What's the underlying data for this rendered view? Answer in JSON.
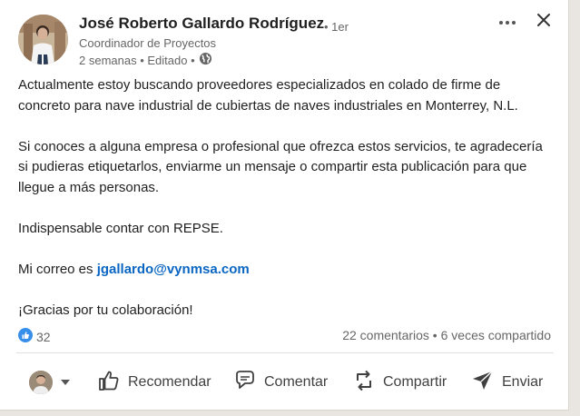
{
  "post": {
    "author": {
      "name": "José Roberto Gallardo Rodríguez",
      "degree": "• 1er",
      "title": "Coordinador de Proyectos",
      "meta": "2 semanas • Editado •"
    },
    "body": {
      "p1": "Actualmente estoy buscando proveedores especializados en colado de firme de concreto para nave industrial de cubiertas de naves industriales en Monterrey, N.L.",
      "p2": "Si conoces a alguna empresa o profesional que ofrezca estos servicios, te agradecería si pudieras etiquetarlos, enviarme un mensaje o compartir esta publicación para que llegue a más personas.",
      "p3": "Indispensable contar con REPSE.",
      "p4_prefix": "Mi correo es ",
      "p4_email": "jgallardo@vynmsa.com",
      "p5": "¡Gracias por tu colaboración!"
    },
    "reactions": {
      "count": "32"
    },
    "stats": "22 comentarios • 6 veces compartido",
    "actions": {
      "like": "Recomendar",
      "comment": "Comentar",
      "share": "Compartir",
      "send": "Enviar"
    },
    "colors": {
      "link": "#0a66c2",
      "like_blue": "#378fe9",
      "text": "#1f1f1f",
      "muted": "#666666"
    }
  }
}
